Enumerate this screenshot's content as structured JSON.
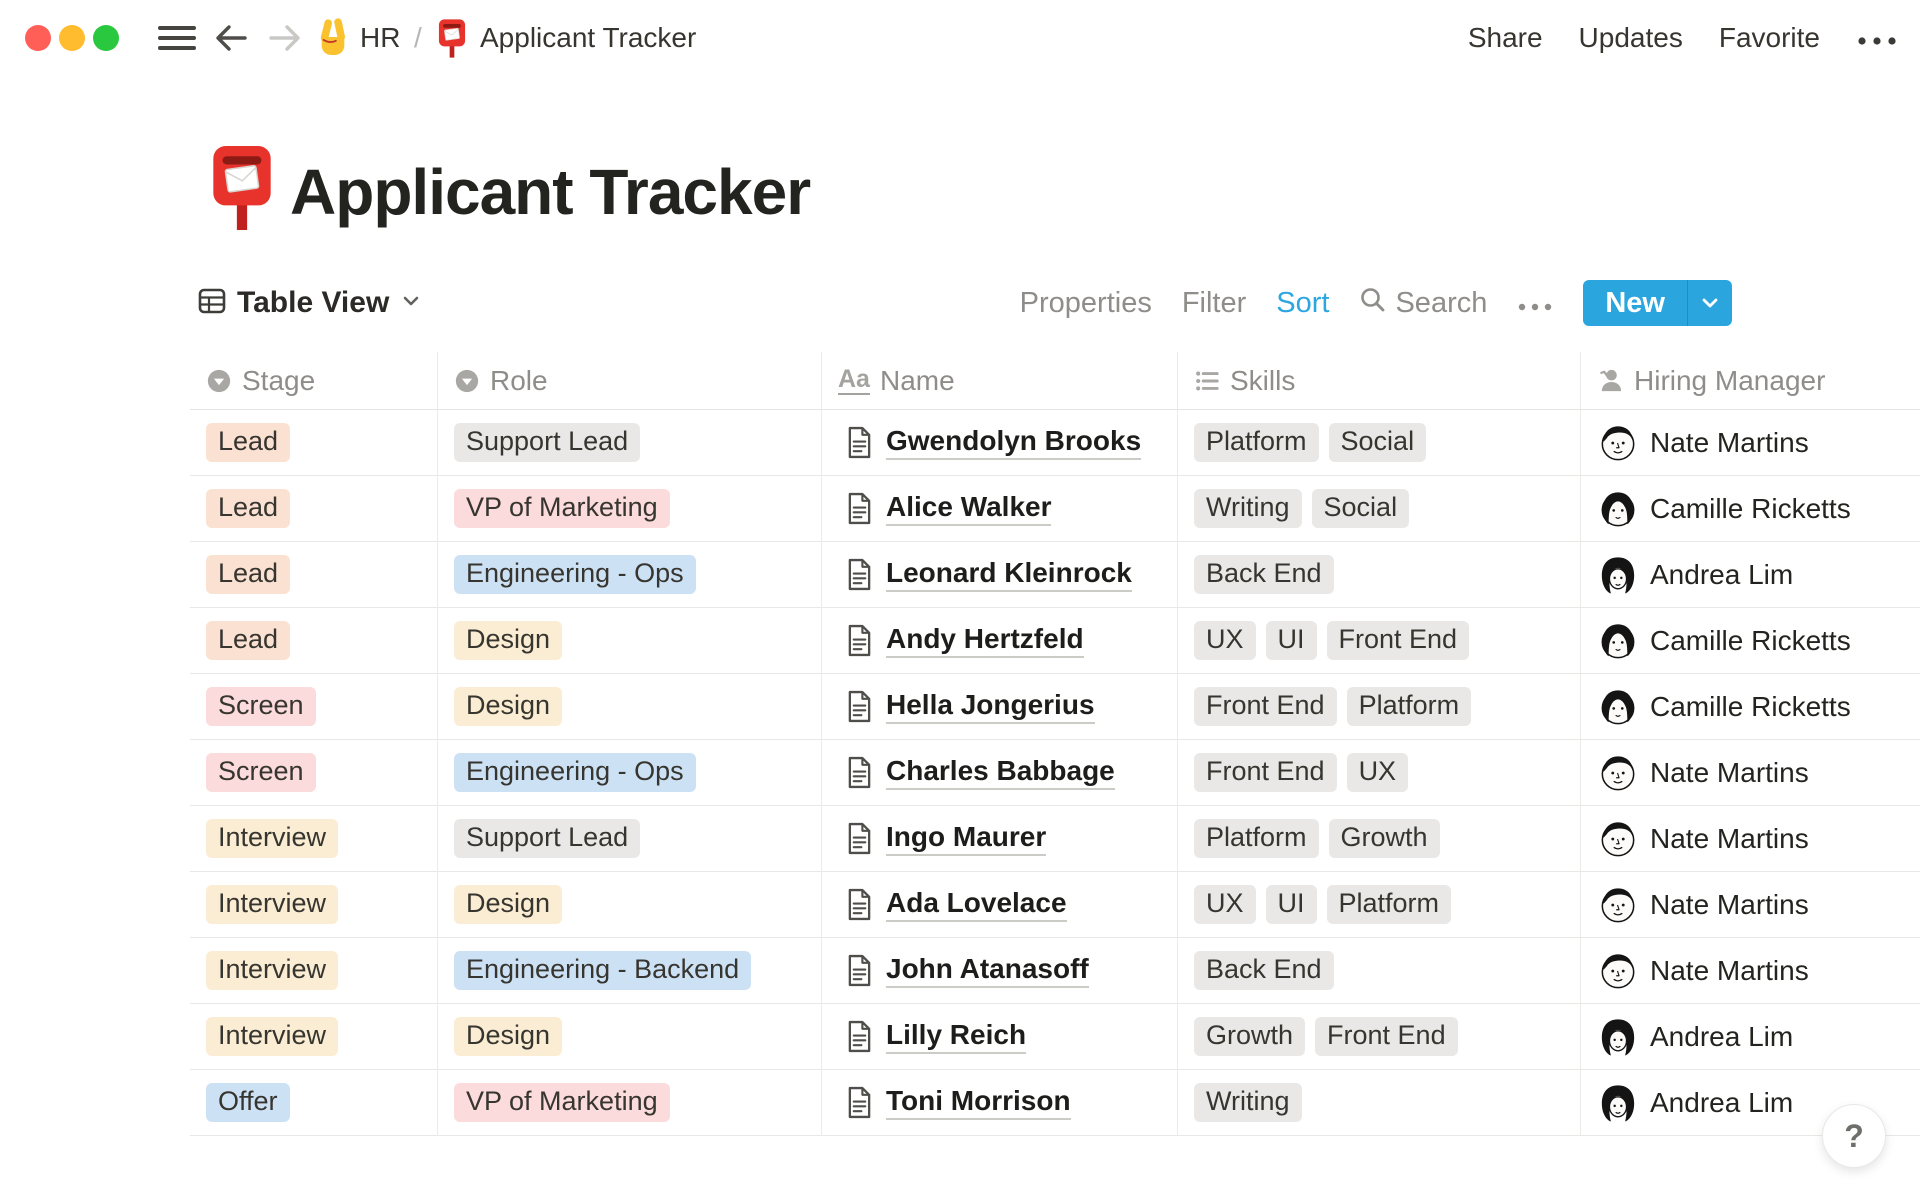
{
  "topbar": {
    "breadcrumb": {
      "workspace_icon": "victory-hand",
      "workspace": "HR",
      "separator": "/",
      "page_icon": "postbox",
      "page": "Applicant Tracker"
    },
    "actions": {
      "share": "Share",
      "updates": "Updates",
      "favorite": "Favorite",
      "more": "•••"
    }
  },
  "page": {
    "icon": "postbox",
    "title": "Applicant Tracker"
  },
  "toolbar": {
    "view_label": "Table View",
    "properties": "Properties",
    "filter": "Filter",
    "sort": "Sort",
    "search": "Search",
    "more": "•••",
    "new_label": "New"
  },
  "table": {
    "columns": [
      {
        "label": "Stage",
        "icon": "select-icon"
      },
      {
        "label": "Role",
        "icon": "select-icon"
      },
      {
        "label": "Name",
        "icon": "text-icon"
      },
      {
        "label": "Skills",
        "icon": "multi-select-icon"
      },
      {
        "label": "Hiring Manager",
        "icon": "person-icon"
      }
    ],
    "rows": [
      {
        "stage": {
          "label": "Lead",
          "color": "orange"
        },
        "role": {
          "label": "Support Lead",
          "color": "gray"
        },
        "name": "Gwendolyn Brooks",
        "skills": [
          "Platform",
          "Social"
        ],
        "manager": {
          "name": "Nate Martins",
          "avatar": "nate-martins"
        }
      },
      {
        "stage": {
          "label": "Lead",
          "color": "orange"
        },
        "role": {
          "label": "VP of Marketing",
          "color": "red"
        },
        "name": "Alice Walker",
        "skills": [
          "Writing",
          "Social"
        ],
        "manager": {
          "name": "Camille Ricketts",
          "avatar": "camille-ricketts"
        }
      },
      {
        "stage": {
          "label": "Lead",
          "color": "orange"
        },
        "role": {
          "label": "Engineering - Ops",
          "color": "blue"
        },
        "name": "Leonard Kleinrock",
        "skills": [
          "Back End"
        ],
        "manager": {
          "name": "Andrea Lim",
          "avatar": "andrea-lim"
        }
      },
      {
        "stage": {
          "label": "Lead",
          "color": "orange"
        },
        "role": {
          "label": "Design",
          "color": "yellow"
        },
        "name": "Andy Hertzfeld",
        "skills": [
          "UX",
          "UI",
          "Front End"
        ],
        "manager": {
          "name": "Camille Ricketts",
          "avatar": "camille-ricketts"
        }
      },
      {
        "stage": {
          "label": "Screen",
          "color": "red"
        },
        "role": {
          "label": "Design",
          "color": "yellow"
        },
        "name": "Hella Jongerius",
        "skills": [
          "Front End",
          "Platform"
        ],
        "manager": {
          "name": "Camille Ricketts",
          "avatar": "camille-ricketts"
        }
      },
      {
        "stage": {
          "label": "Screen",
          "color": "red"
        },
        "role": {
          "label": "Engineering - Ops",
          "color": "blue"
        },
        "name": "Charles Babbage",
        "skills": [
          "Front End",
          "UX"
        ],
        "manager": {
          "name": "Nate Martins",
          "avatar": "nate-martins"
        }
      },
      {
        "stage": {
          "label": "Interview",
          "color": "yellow"
        },
        "role": {
          "label": "Support Lead",
          "color": "gray"
        },
        "name": "Ingo Maurer",
        "skills": [
          "Platform",
          "Growth"
        ],
        "manager": {
          "name": "Nate Martins",
          "avatar": "nate-martins"
        }
      },
      {
        "stage": {
          "label": "Interview",
          "color": "yellow"
        },
        "role": {
          "label": "Design",
          "color": "yellow"
        },
        "name": "Ada Lovelace",
        "skills": [
          "UX",
          "UI",
          "Platform"
        ],
        "manager": {
          "name": "Nate Martins",
          "avatar": "nate-martins"
        }
      },
      {
        "stage": {
          "label": "Interview",
          "color": "yellow"
        },
        "role": {
          "label": "Engineering - Backend",
          "color": "blue"
        },
        "name": "John Atanasoff",
        "skills": [
          "Back End"
        ],
        "manager": {
          "name": "Nate Martins",
          "avatar": "nate-martins"
        }
      },
      {
        "stage": {
          "label": "Interview",
          "color": "yellow"
        },
        "role": {
          "label": "Design",
          "color": "yellow"
        },
        "name": "Lilly Reich",
        "skills": [
          "Growth",
          "Front End"
        ],
        "manager": {
          "name": "Andrea Lim",
          "avatar": "andrea-lim"
        }
      },
      {
        "stage": {
          "label": "Offer",
          "color": "blue"
        },
        "role": {
          "label": "VP of Marketing",
          "color": "red"
        },
        "name": "Toni Morrison",
        "skills": [
          "Writing"
        ],
        "manager": {
          "name": "Andrea Lim",
          "avatar": "andrea-lim"
        }
      }
    ]
  },
  "tag_colors": {
    "gray": "#E9E8E6",
    "orange": "#FAE1D2",
    "red": "#FBDBDB",
    "yellow": "#FAEDD3",
    "blue": "#CDE1F5"
  },
  "accent": {
    "new_button": "#2BA5DE",
    "sort_active": "#2EA7E0"
  },
  "help": {
    "label": "?"
  }
}
